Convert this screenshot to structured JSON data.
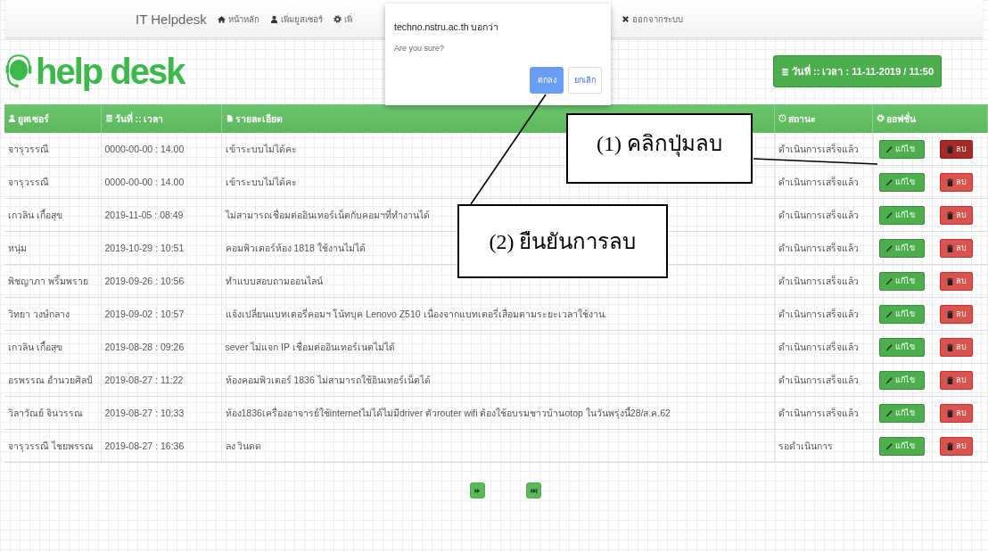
{
  "navbar": {
    "brand": "IT Helpdesk",
    "items": [
      {
        "label": "หน้าหลัก"
      },
      {
        "label": "เพิ่มยูสเซอร์"
      },
      {
        "label": "เพิ่"
      },
      {
        "label": "ออกจากระบบ"
      }
    ]
  },
  "logo": {
    "text": "help desk"
  },
  "datetime_button": "วันที่ :: เวลา : 11-11-2019 / 11:50",
  "dialog": {
    "origin": "techno.nstru.ac.th บอกว่า",
    "message": "Are you sure?",
    "ok": "ตกลง",
    "cancel": "ยกเลิก"
  },
  "table": {
    "columns": [
      {
        "label": "ยูสเซอร์"
      },
      {
        "label": "วันที่ :: เวลา"
      },
      {
        "label": "รายละเอียด"
      },
      {
        "label": "สถานะ"
      },
      {
        "label": "ออฟชั่น"
      }
    ],
    "rows": [
      {
        "user": "จารุวรรณี",
        "datetime": "0000-00-00 : 14.00",
        "detail": "เข้าระบบไม่ได้คะ",
        "status": "ดำเนินการเสร็จแล้ว",
        "edit": "แก้ไข",
        "delete": "ลบ",
        "delete_pressed": true
      },
      {
        "user": "จารุวรรณี",
        "datetime": "0000-00-00 : 14.00",
        "detail": "เข้าระบบไม่ได้คะ",
        "status": "ดำเนินการเสร็จแล้ว",
        "edit": "แก้ไข",
        "delete": "ลบ",
        "delete_pressed": false
      },
      {
        "user": "เกวลิน เกื้อสุข",
        "datetime": "2019-11-05 : 08:49",
        "detail": "ไม่สามารถเชื่อมต่ออินเทอร์เน็ตกับคอมฯที่ทำงานได้",
        "status": "ดำเนินการเสร็จแล้ว",
        "edit": "แก้ไข",
        "delete": "ลบ",
        "delete_pressed": false
      },
      {
        "user": "หนุ่ม",
        "datetime": "2019-10-29 : 10:51",
        "detail": "คอมพิวเตอร์ห้อง 1818 ใช้งานไม่ได้",
        "status": "ดำเนินการเสร็จแล้ว",
        "edit": "แก้ไข",
        "delete": "ลบ",
        "delete_pressed": false
      },
      {
        "user": "พิชญาภา พริ้มพราย",
        "datetime": "2019-09-26 : 10:56",
        "detail": "ทำแบบสอบถามออนไลน์",
        "status": "ดำเนินการเสร็จแล้ว",
        "edit": "แก้ไข",
        "delete": "ลบ",
        "delete_pressed": false
      },
      {
        "user": "วิทยา วงษ์กลาง",
        "datetime": "2019-09-02 : 10:57",
        "detail": "แจ้งเปลี่ยนแบทเตอรี่คอมฯ โน้ทบุค Lenovo Z510 เนื่องจากแบทเตอรี่เสื่อมตามระยะเวลาใช้งาน.",
        "status": "ดำเนินการเสร็จแล้ว",
        "edit": "แก้ไข",
        "delete": "ลบ",
        "delete_pressed": false
      },
      {
        "user": "เกวลิน เกื้อสุข",
        "datetime": "2019-08-28 : 09:26",
        "detail": "sever ไม่แจก IP เชื่อมต่ออินเทอร์เนตไม่ได้",
        "status": "ดำเนินการเสร็จแล้ว",
        "edit": "แก้ไข",
        "delete": "ลบ",
        "delete_pressed": false
      },
      {
        "user": "อรพรรณ อำนวยศิลป์",
        "datetime": "2019-08-27 : 11:22",
        "detail": "ห้องคอมพิวเตอร์ 1836 ไม่สามารถใช้อินเทอร์เน็ตได้",
        "status": "ดำเนินการเสร็จแล้ว",
        "edit": "แก้ไข",
        "delete": "ลบ",
        "delete_pressed": false
      },
      {
        "user": "วิลาวัณย์ จินวรรณ",
        "datetime": "2019-08-27 : 10:33",
        "detail": "ห้อง1836เครื่องอาจารย์ใช้internetไม่ได้ไม่มีdriver ตัวrouter wifi ต้องใช้อบรมชาวบ้านotop ในวันพรุ่งนี้28/ส.ค.62",
        "status": "ดำเนินการเสร็จแล้ว",
        "edit": "แก้ไข",
        "delete": "ลบ",
        "delete_pressed": false
      },
      {
        "user": "จารุวรรณี ไชยพรรณ",
        "datetime": "2019-08-27 : 16:36",
        "detail": "ลง วินดด",
        "status": "รอดำเนินการ",
        "edit": "แก้ไข",
        "delete": "ลบ",
        "delete_pressed": false
      }
    ]
  },
  "pagination": [
    {
      "kind": "next"
    },
    {
      "kind": "last"
    }
  ],
  "callouts": [
    {
      "text": "(1) คลิกปุ่มลบ"
    },
    {
      "text": "(2) ยืนยันการลบ"
    }
  ]
}
